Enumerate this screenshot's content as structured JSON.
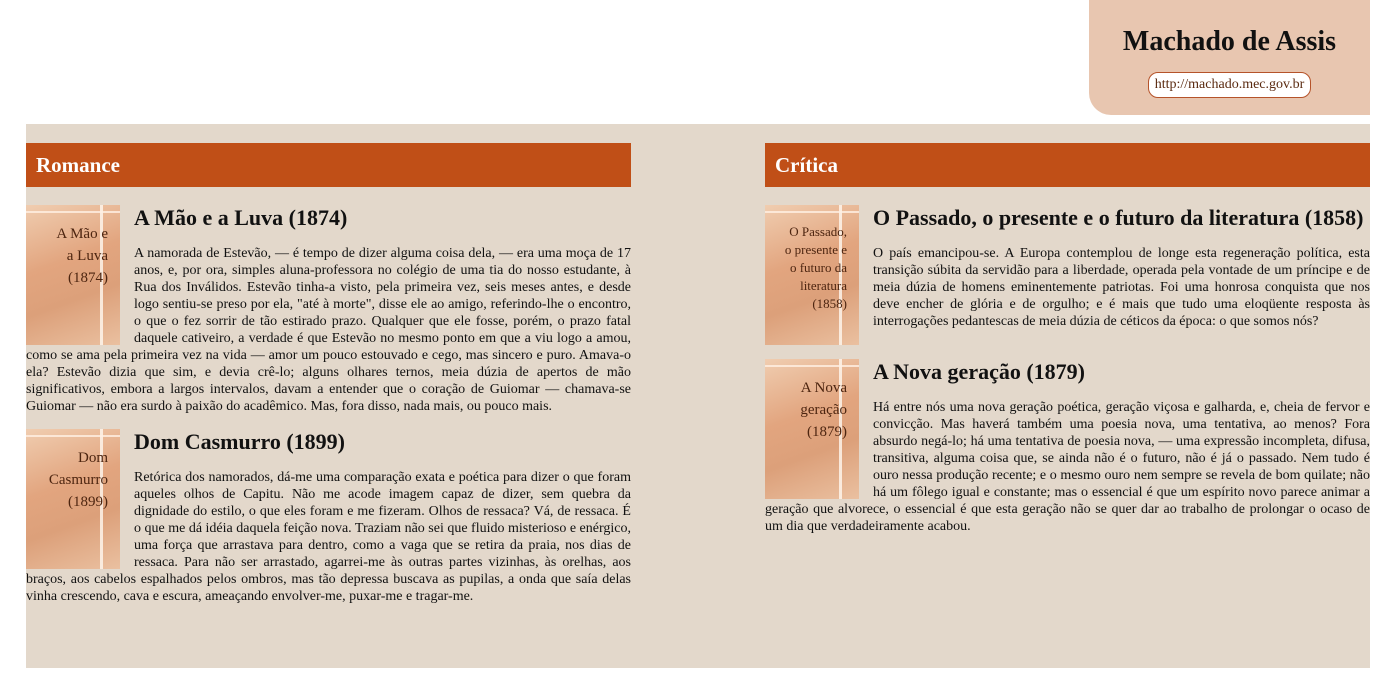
{
  "brand": {
    "title": "Machado de Assis",
    "url": "http://machado.mec.gov.br"
  },
  "sections": [
    {
      "heading": "Romance",
      "entries": [
        {
          "cover_text": "A Mão e a Luva (1874)",
          "title": "A Mão e a Luva (1874)",
          "text": "A namorada de Estevão, — é tempo de dizer alguma coisa dela, — era uma moça de 17 anos, e, por ora, simples aluna-professora no colégio de uma tia do nosso estudante, à Rua dos Inválidos. Estevão tinha-a visto, pela primeira vez, seis meses antes, e desde logo sentiu-se preso por ela, \"até à morte\", disse ele ao amigo, referindo-lhe o encontro, o que o fez sorrir de tão estirado prazo. Qualquer que ele fosse, porém, o prazo fatal daquele cativeiro, a verdade é que Estevão no mesmo ponto em que a viu logo a amou, como se ama pela primeira vez na vida — amor um pouco estouvado e cego, mas sincero e puro. Amava-o ela? Estevão dizia que sim, e devia crê-lo; alguns olhares ternos, meia dúzia de apertos de mão significativos, embora a largos intervalos, davam a entender que o coração de Guiomar — chamava-se Guiomar — não era surdo à paixão do acadêmico. Mas, fora disso, nada mais, ou pouco mais."
        },
        {
          "cover_text": "Dom Casmurro (1899)",
          "title": "Dom Casmurro (1899)",
          "text": "Retórica dos namorados, dá-me uma comparação exata e poética para dizer o que foram aqueles olhos de Capitu. Não me acode imagem capaz de dizer, sem quebra da dignidade do estilo, o que eles foram e me fizeram. Olhos de ressaca? Vá, de ressaca. É o que me dá idéia daquela feição nova. Traziam não sei que fluido misterioso e enérgico, uma força que arrastava para dentro, como a vaga que se retira da praia, nos dias de ressaca. Para não ser arrastado, agarrei-me às outras partes vizinhas, às orelhas, aos braços, aos cabelos espalhados pelos ombros, mas tão depressa buscava as pupilas, a onda que saía delas vinha crescendo, cava e escura, ameaçando envolver-me, puxar-me e tragar-me."
        }
      ]
    },
    {
      "heading": "Crítica",
      "entries": [
        {
          "cover_text": "O Passado, o presente e o futuro da literatura (1858)",
          "title": "O Passado, o presente e o futuro da literatura (1858)",
          "text": "O país emancipou-se. A Europa contemplou de longe esta regeneração política, esta transição súbita da servidão para a liberdade, operada pela vontade de um príncipe e de meia dúzia de homens eminentemente patriotas. Foi uma honrosa conquista que nos deve encher de glória e de orgulho; e é mais que tudo uma eloqüente resposta às interrogações pedantescas de meia dúzia de céticos da época: o que somos nós?"
        },
        {
          "cover_text": "A Nova geração (1879)",
          "title": "A Nova geração (1879)",
          "text": "Há entre nós uma nova geração poética, geração viçosa e galharda, e, cheia de fervor e convicção. Mas haverá também uma poesia nova, uma tentativa, ao menos? Fora absurdo negá-lo; há uma tentativa de poesia nova, — uma expressão incompleta, difusa, transitiva, alguma coisa que, se ainda não é o futuro, não é já o passado. Nem tudo é ouro nessa produção recente; e o mesmo ouro nem sempre se revela de bom quilate; não há um fôlego igual e constante; mas o essencial é que um espírito novo parece animar a geração que alvorece, o essencial é que esta geração não se quer dar ao trabalho de prolongar o ocaso de um dia que verdadeiramente acabou."
        }
      ]
    }
  ]
}
